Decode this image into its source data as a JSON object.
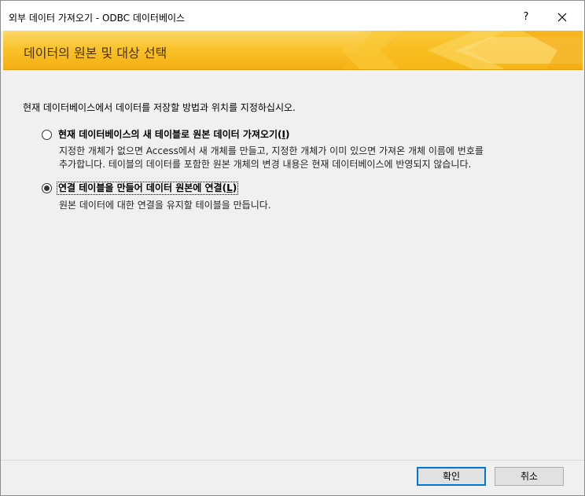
{
  "window": {
    "title": "외부 데이터 가져오기 - ODBC 데이터베이스",
    "help_label": "?"
  },
  "banner": {
    "title": "데이터의 원본 및 대상 선택",
    "colors": {
      "top": "#fcd86a",
      "bottom": "#f4ae13"
    }
  },
  "instruction": "현재 데이터베이스에서 데이터를 저장할 방법과 위치를 지정하십시오.",
  "options": [
    {
      "label": "현재 데이터베이스의 새 테이블로 원본 데이터 가져오기",
      "accelerator": "I",
      "checked": false,
      "description_lines": [
        "지정한 개체가 없으면 Access에서 새 개체를 만들고, 지정한 개체가 이미 있으면 가져온 개체 이름에 번호를",
        "추가합니다. 테이블의 데이터를 포함한 원본 개체의 변경 내용은 현재 데이터베이스에 반영되지 않습니다."
      ]
    },
    {
      "label": "연결 테이블을 만들어 데이터 원본에 연결",
      "accelerator": "L",
      "checked": true,
      "description_lines": [
        "원본 데이터에 대한 연결을 유지할 테이블을 만듭니다."
      ]
    }
  ],
  "buttons": {
    "ok": "확인",
    "cancel": "취소"
  },
  "icons": {
    "close": "close-icon"
  }
}
